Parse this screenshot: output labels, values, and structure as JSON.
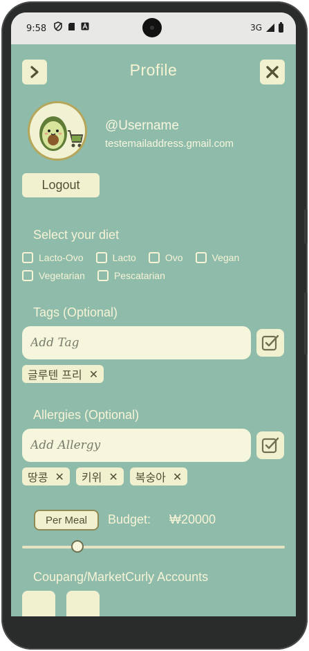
{
  "status": {
    "time": "9:58",
    "network": "3G"
  },
  "header": {
    "title": "Profile",
    "back_icon": "chevron-right-icon",
    "close_icon": "close-icon"
  },
  "profile": {
    "username": "@Username",
    "email": "testemailaddress.gmail.com",
    "logout_label": "Logout"
  },
  "diet": {
    "heading": "Select your diet",
    "options": [
      "Lacto-Ovo",
      "Lacto",
      "Ovo",
      "Vegan",
      "Vegetarian",
      "Pescatarian"
    ]
  },
  "tags": {
    "heading": "Tags (Optional)",
    "placeholder": "Add Tag",
    "chips": [
      "글루텐 프리"
    ]
  },
  "allergies": {
    "heading": "Allergies (Optional)",
    "placeholder": "Add Allergy",
    "chips": [
      "땅콩",
      "키위",
      "복숭아"
    ]
  },
  "budget": {
    "mode_label": "Per Meal",
    "label": "Budget:",
    "value": "₩20000",
    "slider_fraction": 0.21
  },
  "accounts": {
    "heading": "Coupang/MarketCurly Accounts"
  },
  "colors": {
    "background": "#8fbcaa",
    "surface": "#f2f1cf",
    "text_light": "#f6f3d6",
    "text_dark": "#4f5136"
  }
}
